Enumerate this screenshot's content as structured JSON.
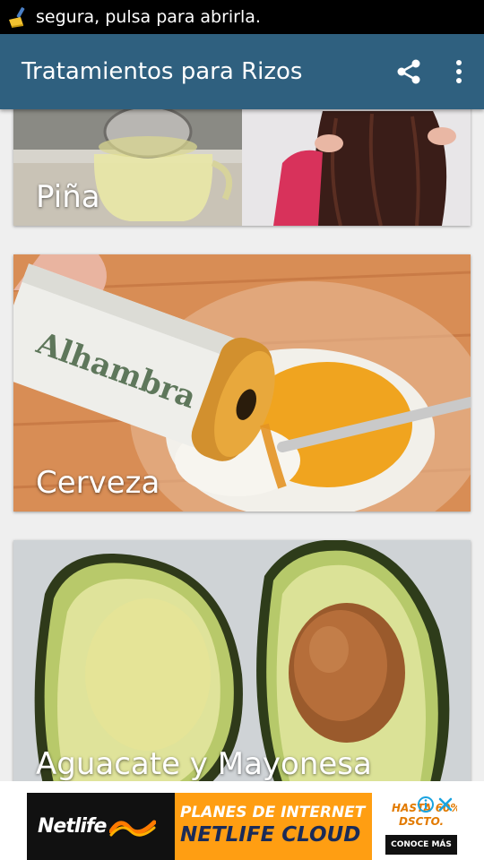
{
  "status_bar": {
    "notification_icon": "broom-cleaner-icon",
    "text": "segura, pulsa para abrirla."
  },
  "app_bar": {
    "title": "Tratamientos para Rizos",
    "actions": [
      "share-icon",
      "overflow-menu-icon"
    ]
  },
  "treatments": [
    {
      "label": "Piña"
    },
    {
      "label": "Cerveza"
    },
    {
      "label": "Aguacate y Mayonesa"
    }
  ],
  "ad": {
    "brand": "Netlife",
    "promo_line1": "PLANES DE INTERNET",
    "promo_line2": "NETLIFE CLOUD",
    "side_line1": "HASTA 60%",
    "side_line2": "DSCTO.",
    "cta": "CONOCE MÁS",
    "info_icon": "ad-info-icon",
    "close_icon": "close-icon"
  },
  "colors": {
    "app_bar": "#2f607f",
    "status_bar": "#000000",
    "ad_orange": "#ff9e12",
    "ad_navy": "#1a2b58"
  }
}
